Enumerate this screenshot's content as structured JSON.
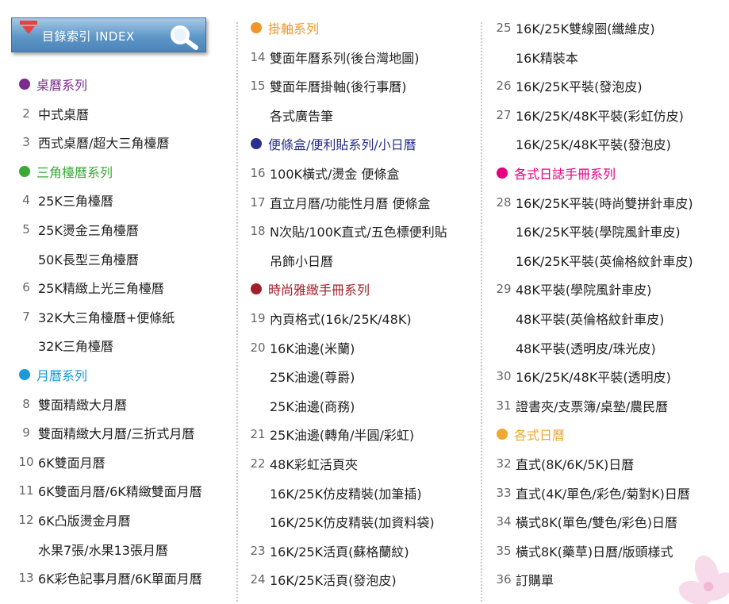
{
  "header": {
    "title": "目錄索引 INDEX"
  },
  "colors": {
    "purple": "#7b2d8e",
    "green": "#3aaa35",
    "blue": "#1a9ad6",
    "orange": "#f0962b",
    "navy": "#2a2f8f",
    "darkred": "#a3202b",
    "magenta": "#e4007f",
    "gold": "#f0a830"
  },
  "col1": [
    {
      "type": "section",
      "label": "桌曆系列",
      "color": "#7b2d8e"
    },
    {
      "type": "item",
      "num": "2",
      "text": "中式桌曆"
    },
    {
      "type": "item",
      "num": "3",
      "text": "西式桌曆/超大三角檯曆"
    },
    {
      "type": "section",
      "label": "三角檯曆系列",
      "color": "#3aaa35"
    },
    {
      "type": "item",
      "num": "4",
      "text": "25K三角檯曆"
    },
    {
      "type": "item",
      "num": "5",
      "text": "25K燙金三角檯曆"
    },
    {
      "type": "item",
      "num": "",
      "text": "50K長型三角檯曆"
    },
    {
      "type": "item",
      "num": "6",
      "text": "25K精緻上光三角檯曆"
    },
    {
      "type": "item",
      "num": "7",
      "text": "32K大三角檯曆+便條紙"
    },
    {
      "type": "item",
      "num": "",
      "text": "32K三角檯曆"
    },
    {
      "type": "section",
      "label": "月曆系列",
      "color": "#1a9ad6"
    },
    {
      "type": "item",
      "num": "8",
      "text": "雙面精緻大月曆"
    },
    {
      "type": "item",
      "num": "9",
      "text": "雙面精緻大月曆/三折式月曆"
    },
    {
      "type": "item",
      "num": "10",
      "text": "6K雙面月曆"
    },
    {
      "type": "item",
      "num": "11",
      "text": "6K雙面月曆/6K精緻雙面月曆"
    },
    {
      "type": "item",
      "num": "12",
      "text": "6K凸版燙金月曆"
    },
    {
      "type": "item",
      "num": "",
      "text": "水果7張/水果13張月曆"
    },
    {
      "type": "item",
      "num": "13",
      "text": "6K彩色記事月曆/6K單面月曆"
    }
  ],
  "col2": [
    {
      "type": "section",
      "label": "掛軸系列",
      "color": "#f0962b"
    },
    {
      "type": "item",
      "num": "14",
      "text": "雙面年曆系列(後台灣地圖)"
    },
    {
      "type": "item",
      "num": "15",
      "text": "雙面年曆掛軸(後行事曆)"
    },
    {
      "type": "item",
      "num": "",
      "text": "各式廣告筆"
    },
    {
      "type": "section",
      "label": "便條盒/便利貼系列/小日曆",
      "color": "#2a2f8f"
    },
    {
      "type": "item",
      "num": "16",
      "text": "100K橫式/燙金 便條盒"
    },
    {
      "type": "item",
      "num": "17",
      "text": "直立月曆/功能性月曆 便條盒"
    },
    {
      "type": "item",
      "num": "18",
      "text": "N次貼/100K直式/五色標便利貼"
    },
    {
      "type": "item",
      "num": "",
      "text": "吊飾小日曆"
    },
    {
      "type": "section",
      "label": "時尚雅緻手冊系列",
      "color": "#a3202b"
    },
    {
      "type": "item",
      "num": "19",
      "text": "內頁格式(16k/25K/48K)"
    },
    {
      "type": "item",
      "num": "20",
      "text": "16K油邊(米蘭)"
    },
    {
      "type": "item",
      "num": "",
      "text": "25K油邊(尊爵)"
    },
    {
      "type": "item",
      "num": "",
      "text": "25K油邊(商務)"
    },
    {
      "type": "item",
      "num": "21",
      "text": "25K油邊(轉角/半圓/彩虹)"
    },
    {
      "type": "item",
      "num": "22",
      "text": "48K彩虹活頁夾"
    },
    {
      "type": "item",
      "num": "",
      "text": "16K/25K仿皮精裝(加筆插)"
    },
    {
      "type": "item",
      "num": "",
      "text": "16K/25K仿皮精裝(加資料袋)"
    },
    {
      "type": "item",
      "num": "23",
      "text": "16K/25K活頁(蘇格蘭紋)"
    },
    {
      "type": "item",
      "num": "24",
      "text": "16K/25K活頁(發泡皮)"
    }
  ],
  "col3": [
    {
      "type": "item",
      "num": "25",
      "text": "16K/25K雙線圈(纖維皮)"
    },
    {
      "type": "item",
      "num": "",
      "text": "16K精裝本"
    },
    {
      "type": "item",
      "num": "26",
      "text": "16K/25K平裝(發泡皮)"
    },
    {
      "type": "item",
      "num": "27",
      "text": "16K/25K/48K平裝(彩虹仿皮)"
    },
    {
      "type": "item",
      "num": "",
      "text": "16K/25K/48K平裝(發泡皮)"
    },
    {
      "type": "section",
      "label": "各式日誌手冊系列",
      "color": "#e4007f"
    },
    {
      "type": "item",
      "num": "28",
      "text": "16K/25K平裝(時尚雙拼針車皮)"
    },
    {
      "type": "item",
      "num": "",
      "text": "16K/25K平裝(學院風針車皮)"
    },
    {
      "type": "item",
      "num": "",
      "text": "16K/25K平裝(英倫格紋針車皮)"
    },
    {
      "type": "item",
      "num": "29",
      "text": "48K平裝(學院風針車皮)"
    },
    {
      "type": "item",
      "num": "",
      "text": "48K平裝(英倫格紋針車皮)"
    },
    {
      "type": "item",
      "num": "",
      "text": "48K平裝(透明皮/珠光皮)"
    },
    {
      "type": "item",
      "num": "30",
      "text": "16K/25K/48K平裝(透明皮)"
    },
    {
      "type": "item",
      "num": "31",
      "text": "證書夾/支票簿/桌墊/農民曆"
    },
    {
      "type": "section",
      "label": "各式日曆",
      "color": "#f0a830"
    },
    {
      "type": "item",
      "num": "32",
      "text": "直式(8K/6K/5K)日曆"
    },
    {
      "type": "item",
      "num": "33",
      "text": "直式(4K/單色/彩色/菊對K)日曆"
    },
    {
      "type": "item",
      "num": "34",
      "text": "橫式8K(單色/雙色/彩色)日曆"
    },
    {
      "type": "item",
      "num": "35",
      "text": "橫式8K(藥草)日曆/版頭樣式"
    },
    {
      "type": "item",
      "num": "36",
      "text": "訂購單"
    }
  ]
}
